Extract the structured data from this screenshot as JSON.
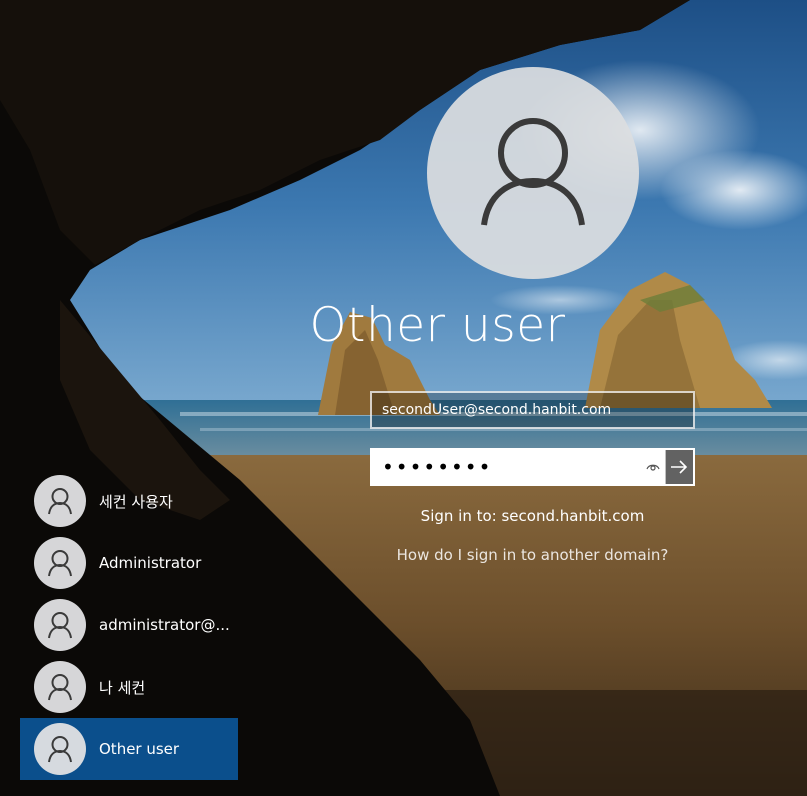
{
  "login": {
    "selected_user_name": "Other user",
    "username_value": "secondUser@second.hanbit.com",
    "password_value": "••••••••",
    "sign_in_to": "Sign in to: second.hanbit.com",
    "other_domain_link": "How do I sign in to another domain?"
  },
  "users": [
    {
      "label": "세컨 사용자"
    },
    {
      "label": "Administrator"
    },
    {
      "label": "administrator@..."
    },
    {
      "label": "나 세컨"
    },
    {
      "label": "Other user"
    }
  ],
  "icons": {
    "avatar": "person-icon",
    "reveal": "eye-icon",
    "submit": "arrow-right-icon"
  },
  "colors": {
    "selected_user_bg": "#0b4f8c",
    "avatar_bg": "#dcdee0"
  }
}
